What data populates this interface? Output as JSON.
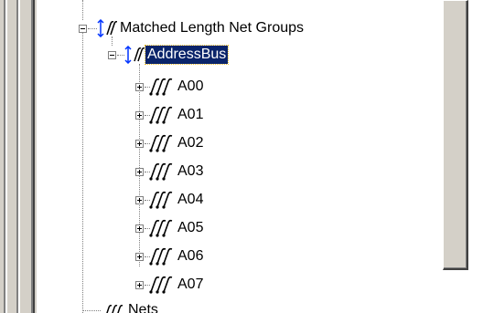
{
  "tree": {
    "group_root": {
      "label": "Matched Length Net Groups",
      "icon": "matched-length-group-icon",
      "expanded": true
    },
    "group": {
      "label": "AddressBus",
      "icon": "matched-length-group-icon",
      "expanded": true,
      "selected": true
    },
    "nets": [
      {
        "label": "A00",
        "icon": "net-icon",
        "expanded": false
      },
      {
        "label": "A01",
        "icon": "net-icon",
        "expanded": false
      },
      {
        "label": "A02",
        "icon": "net-icon",
        "expanded": false
      },
      {
        "label": "A03",
        "icon": "net-icon",
        "expanded": false
      },
      {
        "label": "A04",
        "icon": "net-icon",
        "expanded": false
      },
      {
        "label": "A05",
        "icon": "net-icon",
        "expanded": false
      },
      {
        "label": "A06",
        "icon": "net-icon",
        "expanded": false
      },
      {
        "label": "A07",
        "icon": "net-icon",
        "expanded": false
      }
    ],
    "next_node": {
      "label": "Nets",
      "icon": "net-icon"
    }
  },
  "colors": {
    "selection": "#0a246a",
    "group_icon_accent": "#0033ff",
    "frame": "#d4d0c8"
  }
}
